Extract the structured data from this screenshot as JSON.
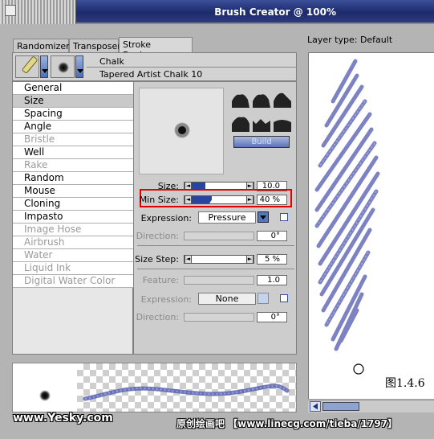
{
  "window": {
    "title": "Brush Creator @ 100%"
  },
  "tabs": [
    {
      "label": "Randomizer"
    },
    {
      "label": "Transposer"
    },
    {
      "label": "Stroke Designer",
      "active": true
    }
  ],
  "brush": {
    "category": "Chalk",
    "variant": "Tapered Artist Chalk 10",
    "category_icon": "chalk-icon",
    "dab_icon": "dab-icon"
  },
  "categories": [
    {
      "label": "General",
      "enabled": true
    },
    {
      "label": "Size",
      "enabled": true,
      "selected": true
    },
    {
      "label": "Spacing",
      "enabled": true
    },
    {
      "label": "Angle",
      "enabled": true
    },
    {
      "label": "Bristle",
      "enabled": false
    },
    {
      "label": "Well",
      "enabled": true
    },
    {
      "label": "Rake",
      "enabled": false
    },
    {
      "label": "Random",
      "enabled": true
    },
    {
      "label": "Mouse",
      "enabled": true
    },
    {
      "label": "Cloning",
      "enabled": true
    },
    {
      "label": "Impasto",
      "enabled": true
    },
    {
      "label": "Image Hose",
      "enabled": false
    },
    {
      "label": "Airbrush",
      "enabled": false
    },
    {
      "label": "Water",
      "enabled": false
    },
    {
      "label": "Liquid Ink",
      "enabled": false
    },
    {
      "label": "Digital Water Color",
      "enabled": false
    }
  ],
  "size_panel": {
    "build_label": "Build",
    "size": {
      "label": "Size:",
      "value": "10.0",
      "level": 0.3
    },
    "min_size": {
      "label": "Min Size:",
      "value": "40 %",
      "level": 0.4,
      "highlighted": true
    },
    "expression1": {
      "label": "Expression:",
      "value": "Pressure"
    },
    "direction1": {
      "label": "Direction:",
      "value": "0°"
    },
    "size_step": {
      "label": "Size Step:",
      "value": "5 %",
      "level": 0.05
    },
    "feature": {
      "label": "Feature:",
      "value": "1.0"
    },
    "expression2": {
      "label": "Expression:",
      "value": "None"
    },
    "direction2": {
      "label": "Direction:",
      "value": "0°"
    }
  },
  "right_panel": {
    "layer_type": "Layer type: Default"
  },
  "canvas_caption": "图1.4.6",
  "watermarks": {
    "left": "www.Yesky.com",
    "right": "原创绘画吧 【www.linecg.com/tieba/1797】"
  },
  "colors": {
    "highlight": "#e00000",
    "stroke": "#5660b0",
    "accent": "#2746a0"
  }
}
